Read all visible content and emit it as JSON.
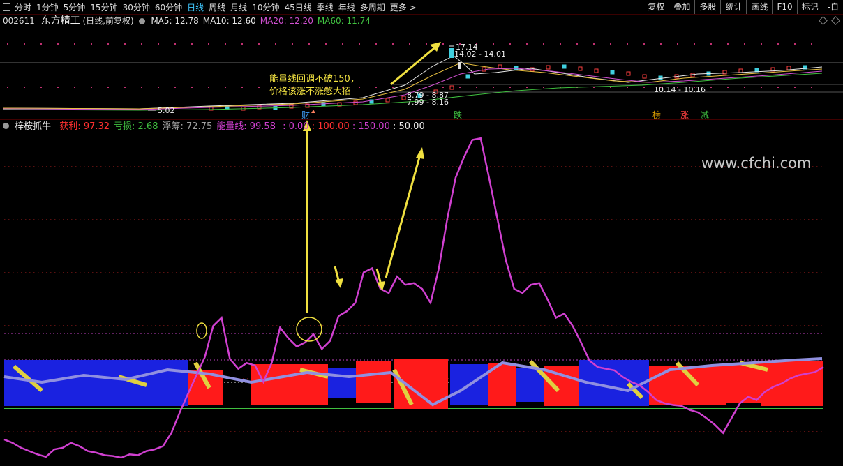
{
  "toolbar": {
    "periods": [
      "分时",
      "1分钟",
      "5分钟",
      "15分钟",
      "30分钟",
      "60分钟",
      "日线",
      "周线",
      "月线",
      "10分钟",
      "45日线",
      "季线",
      "年线",
      "多周期",
      "更多 >"
    ],
    "active_period": "日线",
    "right_buttons": [
      "复权",
      "叠加",
      "多股",
      "统计",
      "画线",
      "F10",
      "标记",
      "-自"
    ]
  },
  "stock": {
    "code": "002611",
    "name": "东方精工",
    "mode": "(日线,前复权)",
    "ma": [
      {
        "label": "MA5:",
        "value": "12.78",
        "color": "#e8e8e8"
      },
      {
        "label": "MA10:",
        "value": "12.60",
        "color": "#e8e8e8"
      },
      {
        "label": "MA20:",
        "value": "12.20",
        "color": "#d050d0"
      },
      {
        "label": "MA60:",
        "value": "11.74",
        "color": "#40c040"
      }
    ]
  },
  "price_panel": {
    "labels": {
      "high": "17.14",
      "range_top": "14.02 - 14.01",
      "range_mid": "8.79 - 8.87",
      "range_low": "7.99 - 8.16",
      "range_right": "10.14 - 10.16",
      "low": "5.02"
    },
    "markers": [
      {
        "text": "财",
        "color": "#40a0ff"
      },
      {
        "text": "跌",
        "color": "#40c040"
      },
      {
        "text": "榜",
        "color": "#e0a000"
      },
      {
        "text": "涨",
        "color": "#ff4040"
      },
      {
        "text": "减",
        "color": "#40c040"
      }
    ],
    "annotation_line1": "能量线回调不破150，",
    "annotation_line2": "价格该涨不涨憋大招"
  },
  "indicator": {
    "name": "梓桉抓牛",
    "items": [
      {
        "label": "获利:",
        "value": "97.32",
        "color": "#ff3030"
      },
      {
        "label": "亏损:",
        "value": "2.68",
        "color": "#40c040"
      },
      {
        "label": "浮筹:",
        "value": "72.75",
        "color": "#a0a0a0"
      },
      {
        "label": "能量线:",
        "value": "99.58",
        "color": "#d040d0"
      }
    ],
    "levels": [
      {
        "value": "0.00",
        "color": "#d040d0"
      },
      {
        "value": "100.00",
        "color": "#ff3030"
      },
      {
        "value": "150.00",
        "color": "#d040d0"
      },
      {
        "value": "50.00",
        "color": "#e8e8e8"
      }
    ],
    "energy_line": [
      22,
      18,
      12,
      8,
      4,
      1,
      10,
      12,
      18,
      14,
      8,
      6,
      3,
      2,
      0,
      4,
      3,
      8,
      10,
      14,
      30,
      55,
      78,
      100,
      122,
      160,
      170,
      120,
      108,
      115,
      112,
      92,
      115,
      158,
      145,
      135,
      140,
      150,
      132,
      142,
      172,
      178,
      188,
      225,
      230,
      205,
      200,
      220,
      210,
      212,
      205,
      188,
      230,
      290,
      340,
      365,
      386,
      388,
      340,
      290,
      240,
      205,
      200,
      210,
      212,
      192,
      170,
      175,
      160,
      140,
      118,
      110,
      108,
      106,
      98,
      92,
      88,
      80,
      70,
      66,
      64,
      63,
      58,
      55,
      48,
      40,
      30,
      48,
      66,
      74,
      70,
      80,
      86,
      90,
      96,
      100,
      102,
      104,
      110
    ]
  },
  "watermark": "www.cfchi.com"
}
